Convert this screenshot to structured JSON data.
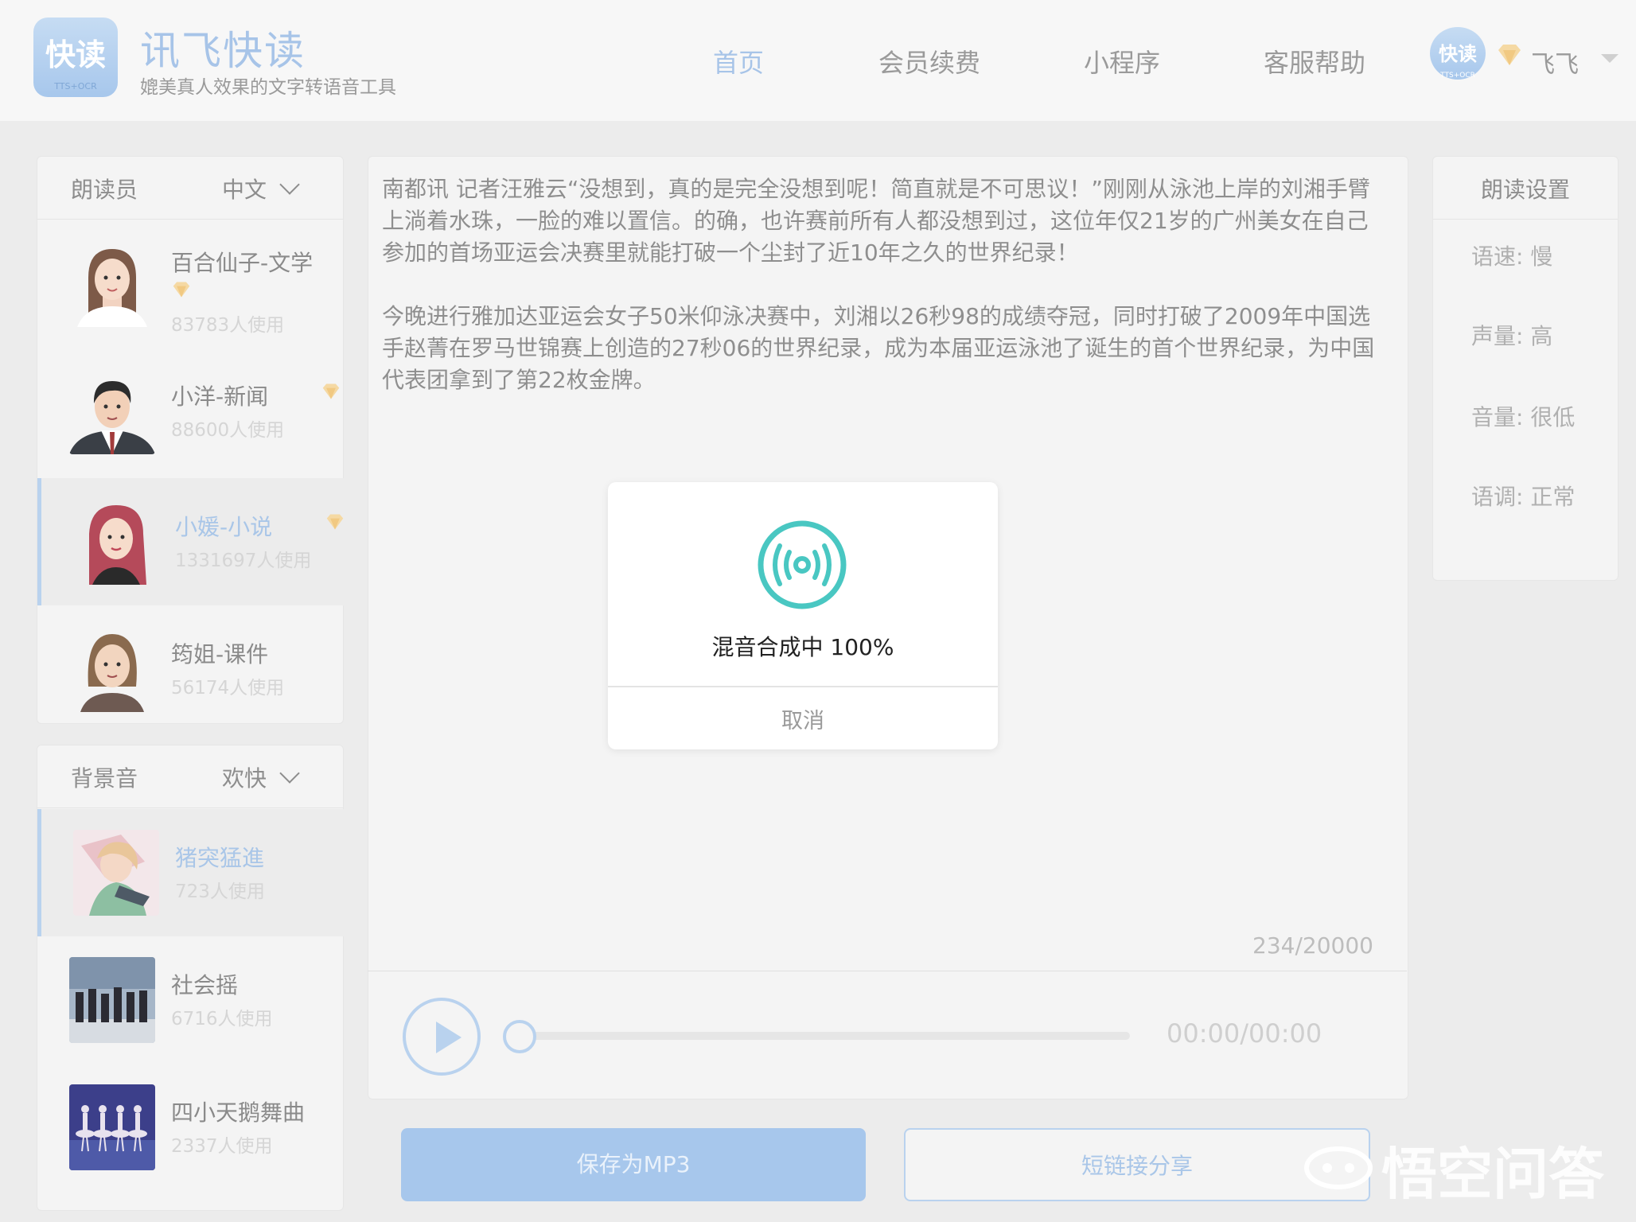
{
  "header": {
    "logo_text": "快读",
    "logo_sub": "TTS+OCR",
    "brand": "讯飞快读",
    "slogan": "媲美真人效果的文字转语音工具",
    "nav": [
      "首页",
      "会员续费",
      "小程序",
      "客服帮助"
    ],
    "avatar_text": "快读",
    "avatar_sub": "TTS+OCR",
    "username": "飞飞"
  },
  "readers_panel": {
    "title": "朗读员",
    "language": "中文",
    "items": [
      {
        "name": "百合仙子-文学",
        "count": "83783人使用",
        "vip": true
      },
      {
        "name": "小洋-新闻",
        "count": "88600人使用",
        "vip": true
      },
      {
        "name": "小媛-小说",
        "count": "1331697人使用",
        "vip": true,
        "selected": true
      },
      {
        "name": "筠姐-课件",
        "count": "56174人使用",
        "vip": false
      }
    ]
  },
  "bgm_panel": {
    "title": "背景音",
    "mood": "欢快",
    "items": [
      {
        "name": "猪突猛進",
        "count": "723人使用",
        "selected": true
      },
      {
        "name": "社会摇",
        "count": "6716人使用"
      },
      {
        "name": "四小天鹅舞曲",
        "count": "2337人使用"
      }
    ]
  },
  "editor": {
    "paragraph1": "南都讯 记者汪雅云“没想到，真的是完全没想到呢！简直就是不可思议！”刚刚从泳池上岸的刘湘手臂上淌着水珠，一脸的难以置信。的确，也许赛前所有人都没想到过，这位年仅21岁的广州美女在自己参加的首场亚运会决赛里就能打破一个尘封了近10年之久的世界纪录！",
    "paragraph2": "今晚进行雅加达亚运会女子50米仰泳决赛中，刘湘以26秒98的成绩夺冠，同时打破了2009年中国选手赵菁在罗马世锦赛上创造的27秒06的世界纪录，成为本届亚运泳池了诞生的首个世界纪录，为中国代表团拿到了第22枚金牌。",
    "counter": "234/20000",
    "time": "00:00/00:00",
    "progress": 0
  },
  "actions": {
    "save": "保存为MP3",
    "share": "短链接分享"
  },
  "settings": {
    "title": "朗读设置",
    "items": [
      "语速: 慢",
      "声量: 高",
      "音量: 很低",
      "语调: 正常"
    ]
  },
  "modal": {
    "status": "混音合成中 100%",
    "cancel": "取消",
    "accent": "#49c7c2"
  },
  "watermark": "悟空问答"
}
